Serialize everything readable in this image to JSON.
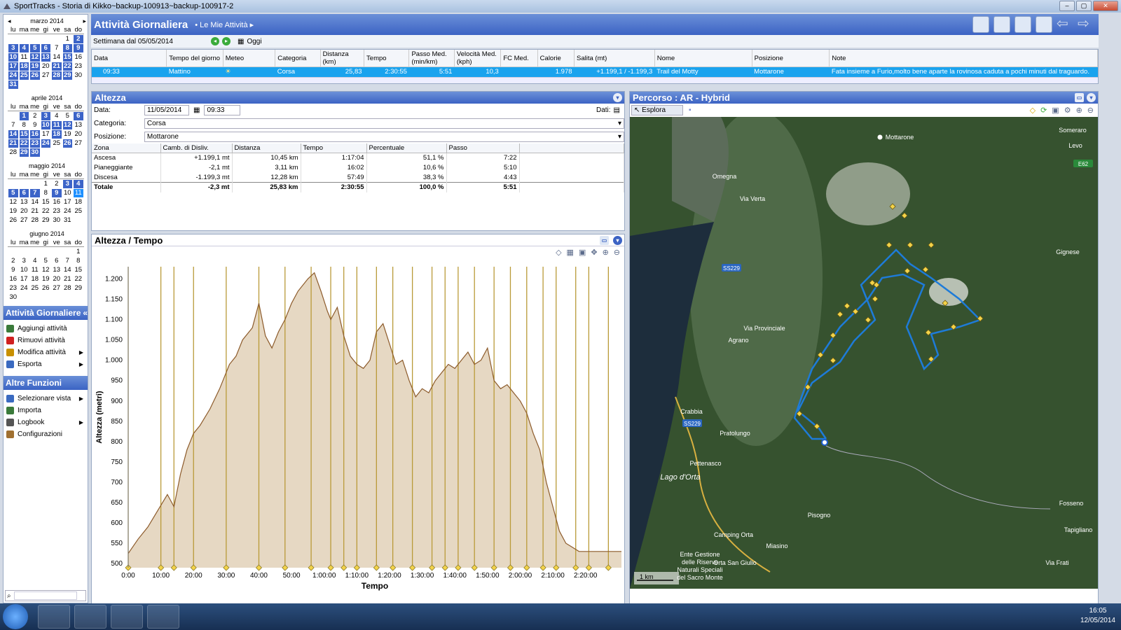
{
  "window": {
    "title": "SportTracks - Storia di Kikko~backup-100913~backup-100917-2"
  },
  "calendars": [
    {
      "month": "marzo 2014",
      "weekdays": [
        "lu",
        "ma",
        "me",
        "gi",
        "ve",
        "sa",
        "do"
      ],
      "days": [
        [
          "",
          "",
          "",
          "",
          "",
          "1",
          "2"
        ],
        [
          "3",
          "4",
          "5",
          "6",
          "7",
          "8",
          "9"
        ],
        [
          "10",
          "11",
          "12",
          "13",
          "14",
          "15",
          "16"
        ],
        [
          "17",
          "18",
          "19",
          "20",
          "21",
          "22",
          "23"
        ],
        [
          "24",
          "25",
          "26",
          "27",
          "28",
          "29",
          "30"
        ],
        [
          "31",
          "",
          "",
          "",
          "",
          "",
          ""
        ]
      ],
      "bold": [
        "2",
        "3",
        "4",
        "5",
        "6",
        "8",
        "9",
        "10",
        "12",
        "13",
        "15",
        "17",
        "18",
        "19",
        "21",
        "22",
        "24",
        "25",
        "26",
        "28",
        "29",
        "31"
      ]
    },
    {
      "month": "aprile 2014",
      "weekdays": [
        "lu",
        "ma",
        "me",
        "gi",
        "ve",
        "sa",
        "do"
      ],
      "days": [
        [
          "",
          "1",
          "2",
          "3",
          "4",
          "5",
          "6"
        ],
        [
          "7",
          "8",
          "9",
          "10",
          "11",
          "12",
          "13"
        ],
        [
          "14",
          "15",
          "16",
          "17",
          "18",
          "19",
          "20"
        ],
        [
          "21",
          "22",
          "23",
          "24",
          "25",
          "26",
          "27"
        ],
        [
          "28",
          "29",
          "30",
          "",
          "",
          "",
          ""
        ]
      ],
      "bold": [
        "1",
        "3",
        "6",
        "10",
        "11",
        "12",
        "14",
        "15",
        "16",
        "18",
        "21",
        "22",
        "23",
        "24",
        "26",
        "29",
        "30"
      ]
    },
    {
      "month": "maggio 2014",
      "weekdays": [
        "lu",
        "ma",
        "me",
        "gi",
        "ve",
        "sa",
        "do"
      ],
      "days": [
        [
          "",
          "",
          "",
          "1",
          "2",
          "3",
          "4"
        ],
        [
          "5",
          "6",
          "7",
          "8",
          "9",
          "10",
          "11"
        ],
        [
          "12",
          "13",
          "14",
          "15",
          "16",
          "17",
          "18"
        ],
        [
          "19",
          "20",
          "21",
          "22",
          "23",
          "24",
          "25"
        ],
        [
          "26",
          "27",
          "28",
          "29",
          "30",
          "31",
          ""
        ]
      ],
      "bold": [
        "3",
        "4",
        "5",
        "6",
        "7",
        "9"
      ],
      "today": [
        "11"
      ]
    },
    {
      "month": "giugno 2014",
      "weekdays": [
        "lu",
        "ma",
        "me",
        "gi",
        "ve",
        "sa",
        "do"
      ],
      "days": [
        [
          "",
          "",
          "",
          "",
          "",
          "",
          "1"
        ],
        [
          "2",
          "3",
          "4",
          "5",
          "6",
          "7",
          "8"
        ],
        [
          "9",
          "10",
          "11",
          "12",
          "13",
          "14",
          "15"
        ],
        [
          "16",
          "17",
          "18",
          "19",
          "20",
          "21",
          "22"
        ],
        [
          "23",
          "24",
          "25",
          "26",
          "27",
          "28",
          "29"
        ],
        [
          "30",
          "",
          "",
          "",
          "",
          "",
          ""
        ]
      ],
      "bold": []
    }
  ],
  "left_sections": {
    "activities": {
      "title": "Attività Giornaliere",
      "items": [
        {
          "label": "Aggiungi attività",
          "icon": "add-icon",
          "arrow": false
        },
        {
          "label": "Rimuovi attività",
          "icon": "remove-icon",
          "arrow": false
        },
        {
          "label": "Modifica attività",
          "icon": "edit-icon",
          "arrow": true
        },
        {
          "label": "Esporta",
          "icon": "export-icon",
          "arrow": true
        }
      ]
    },
    "other": {
      "title": "Altre Funzioni",
      "items": [
        {
          "label": "Selezionare vista",
          "icon": "view-icon",
          "arrow": true
        },
        {
          "label": "Importa",
          "icon": "import-icon",
          "arrow": false
        },
        {
          "label": "Logbook",
          "icon": "logbook-icon",
          "arrow": true
        },
        {
          "label": "Configurazioni",
          "icon": "gear-icon",
          "arrow": false
        }
      ]
    }
  },
  "header": {
    "title": "Attività Giornaliera",
    "breadcrumb": "Le Mie Attività"
  },
  "week": {
    "label": "Settimana dal 05/05/2014",
    "today": "Oggi"
  },
  "activity_table": {
    "columns": [
      "Data",
      "Tempo del giorno",
      "Meteo",
      "Categoria",
      "Distanza (km)",
      "Tempo",
      "Passo Med. (min/km)",
      "Velocità Med. (kph)",
      "FC Med.",
      "Calorie",
      "Salita (mt)",
      "Nome",
      "Posizione",
      "Note"
    ],
    "row": {
      "Data": "09:33",
      "Tempo del giorno": "Mattino",
      "Meteo": "",
      "Categoria": "Corsa",
      "Distanza (km)": "25,83",
      "Tempo": "2:30:55",
      "Passo Med. (min/km)": "5:51",
      "Velocità Med. (kph)": "10,3",
      "FC Med.": "",
      "Calorie": "1.978",
      "Salita (mt)": "+1.199,1 / -1.199,3",
      "Nome": "Trail del Motty",
      "Posizione": "Mottarone",
      "Note": "Fata insieme a Furio,molto bene aparte la rovinosa caduta a pochi minuti dal traguardo."
    }
  },
  "altezza": {
    "title": "Altezza",
    "date_label": "Data:",
    "date": "11/05/2014",
    "time": "09:33",
    "data_label": "Dati:",
    "category_label": "Categoria:",
    "category": "Corsa",
    "position_label": "Posizione:",
    "position": "Mottarone",
    "zone_columns": [
      "Zona",
      "Camb. di Disliv.",
      "Distanza",
      "Tempo",
      "Percentuale",
      "Passo"
    ],
    "zones": [
      {
        "zona": "Ascesa",
        "disliv": "+1.199,1 mt",
        "dist": "10,45 km",
        "tempo": "1:17:04",
        "perc": "51,1 %",
        "passo": "7:22"
      },
      {
        "zona": "Pianeggiante",
        "disliv": "-2,1 mt",
        "dist": "3,11 km",
        "tempo": "16:02",
        "perc": "10,6 %",
        "passo": "5:10"
      },
      {
        "zona": "Discesa",
        "disliv": "-1.199,3 mt",
        "dist": "12,28 km",
        "tempo": "57:49",
        "perc": "38,3 %",
        "passo": "4:43"
      }
    ],
    "total": {
      "zona": "Totale",
      "disliv": "-2,3 mt",
      "dist": "25,83 km",
      "tempo": "2:30:55",
      "perc": "100,0 %",
      "passo": "5:51"
    }
  },
  "chart_data": {
    "type": "area",
    "title": "Altezza / Tempo",
    "xlabel": "Tempo",
    "ylabel": "Altezza (metri)",
    "x_ticks": [
      "0:00",
      "10:00",
      "20:00",
      "30:00",
      "40:00",
      "50:00",
      "1:00:00",
      "1:10:00",
      "1:20:00",
      "1:30:00",
      "1:40:00",
      "1:50:00",
      "2:00:00",
      "2:10:00",
      "2:20:00"
    ],
    "y_ticks": [
      "500",
      "550",
      "600",
      "650",
      "700",
      "750",
      "800",
      "850",
      "900",
      "950",
      "1.000",
      "1.050",
      "1.100",
      "1.150",
      "1.200"
    ],
    "xlim_min": [
      0,
      151
    ],
    "ylim": [
      490,
      1230
    ],
    "x_min": [
      0,
      3,
      6,
      9,
      12,
      14,
      16,
      18,
      20,
      22,
      25,
      28,
      31,
      33,
      35,
      38,
      40,
      42,
      44,
      46,
      48,
      50,
      52,
      55,
      57,
      59,
      61,
      62,
      64,
      66,
      68,
      70,
      72,
      74,
      76,
      78,
      80,
      82,
      84,
      86,
      88,
      90,
      92,
      94,
      96,
      98,
      100,
      102,
      104,
      106,
      108,
      110,
      112,
      114,
      116,
      118,
      120,
      122,
      124,
      126,
      128,
      130,
      132,
      134,
      136,
      138,
      140,
      142,
      144,
      146,
      148,
      150,
      151
    ],
    "y_m": [
      525,
      560,
      590,
      630,
      670,
      640,
      720,
      780,
      820,
      840,
      880,
      930,
      990,
      1010,
      1050,
      1080,
      1140,
      1060,
      1030,
      1070,
      1100,
      1140,
      1170,
      1200,
      1215,
      1170,
      1120,
      1100,
      1130,
      1060,
      1010,
      990,
      980,
      1000,
      1070,
      1090,
      1040,
      990,
      1000,
      950,
      910,
      930,
      920,
      950,
      970,
      990,
      980,
      1000,
      1020,
      990,
      1000,
      1030,
      950,
      930,
      940,
      920,
      900,
      870,
      820,
      780,
      700,
      640,
      580,
      550,
      540,
      530,
      530,
      530,
      530,
      530,
      530,
      530,
      530
    ]
  },
  "chart_markers": {
    "splits": [
      0,
      10,
      14,
      20,
      30,
      40,
      48,
      56,
      62,
      66,
      70,
      76,
      81,
      87,
      93,
      97,
      101,
      106,
      112,
      117,
      122,
      127,
      131,
      137,
      141,
      147
    ]
  },
  "map": {
    "title": "Percorso  : AR - Hybrid",
    "explore": "Esplora",
    "labels": [
      "Mottarone",
      "Omegna",
      "Crabbia",
      "Pratolungo",
      "Pettenasco",
      "Lago d'Orta",
      "Pisogno",
      "Camping Orta",
      "Orta San Giulio",
      "Miasino",
      "Ente Gestione delle Riserve Naturali Speciali del Sacro Monte",
      "Agrano",
      "Gignese",
      "Fosseno",
      "Tapigliano",
      "Levo",
      "Someraro",
      "SS229",
      "SS229",
      "E62",
      "Via Provinciale",
      "Via Verta",
      "Via Frati"
    ],
    "scale": "1 km",
    "route_color": "#1e7bd8"
  },
  "taskbar": {
    "time": "16:05",
    "date": "12/05/2014"
  }
}
